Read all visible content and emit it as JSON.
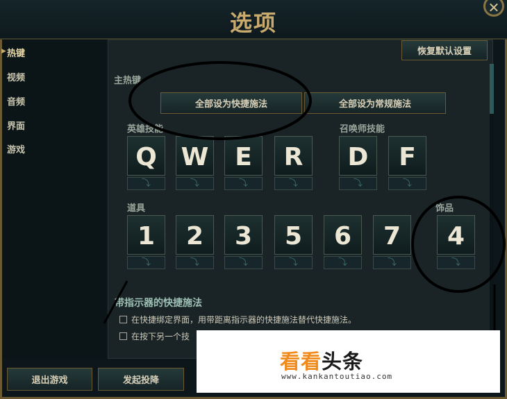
{
  "window": {
    "title": "选项"
  },
  "sidebar": {
    "items": [
      {
        "label": "热键"
      },
      {
        "label": "视频"
      },
      {
        "label": "音频"
      },
      {
        "label": "界面"
      },
      {
        "label": "游戏"
      }
    ]
  },
  "main": {
    "restore_defaults": "恢复默认设置",
    "section_main_hotkeys": "主热键",
    "set_all_quick": "全部设为快捷施法",
    "set_all_normal": "全部设为常规施法",
    "champion_abilities_label": "英雄技能",
    "summoner_spells_label": "召唤师技能",
    "items_label": "道具",
    "trinket_label": "饰品",
    "ability_keys": [
      "Q",
      "W",
      "E",
      "R"
    ],
    "summoner_keys": [
      "D",
      "F"
    ],
    "item_keys": [
      "1",
      "2",
      "3",
      "5",
      "6",
      "7"
    ],
    "trinket_key": "4",
    "quickcast_section": "带指示器的快捷施法",
    "options": [
      "在快捷绑定界面，用带距离指示器的快捷施法替代快捷施法。",
      "在按下另一个技"
    ]
  },
  "footer": {
    "exit_game": "退出游戏",
    "surrender": "发起投降"
  },
  "watermark": {
    "brand_orange": "看看",
    "brand_dark": "头条",
    "url": "www.kankantoutiao.com"
  }
}
